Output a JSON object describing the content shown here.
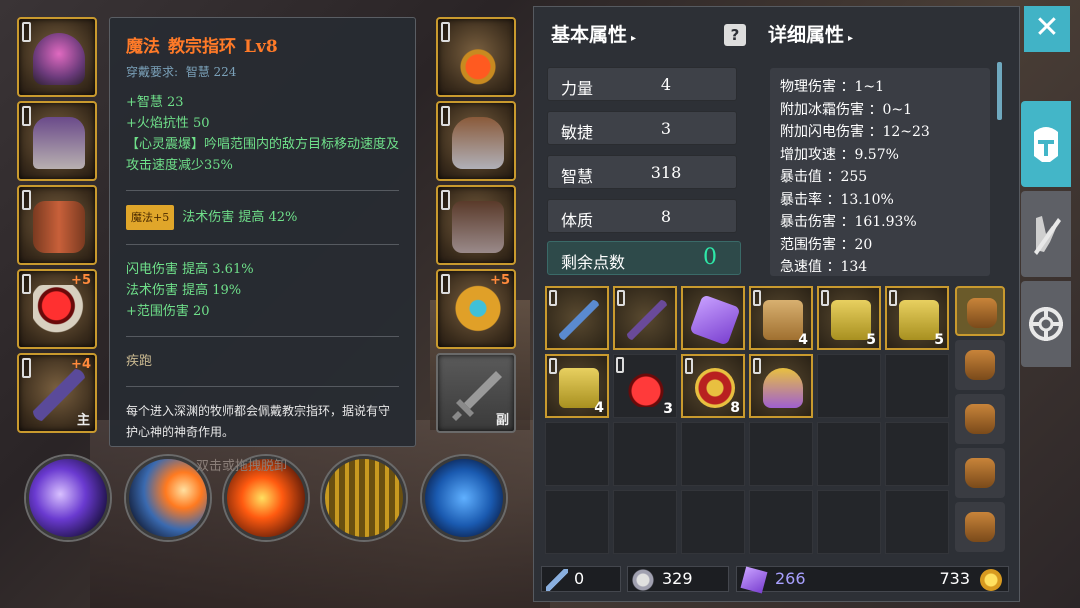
{
  "tooltip": {
    "type": "魔法",
    "name": "教宗指环",
    "level": "Lv8",
    "requirement_label": "穿戴要求:",
    "requirement_stat": "智慧",
    "requirement_value": "224",
    "base_stats": [
      "+智慧 23",
      "+火焰抗性 50",
      "【心灵震爆】吟唱范围内的敌方目标移动速度及攻击速度减少35%"
    ],
    "enchant_badge": "魔法+5",
    "enchant_text": "法术伤害 提高 42%",
    "extra_stats": [
      "闪电伤害 提高 3.61%",
      "法术伤害 提高 19%",
      "+范围伤害 20"
    ],
    "set_skill": "疾跑",
    "description": "每个进入深渊的牧师都会佩戴教宗指环，据说有守护心神的神奇作用。"
  },
  "equipment": {
    "weapon_plus": "+4",
    "weapon_sub": "主",
    "ring_left_plus": "+5",
    "ring_right_plus": "+5",
    "offhand_sub": "副"
  },
  "skills_hint": "双击或拖拽脱卸",
  "attributes": {
    "header": "基本属性",
    "items": [
      {
        "label": "力量",
        "value": "4"
      },
      {
        "label": "敏捷",
        "value": "3"
      },
      {
        "label": "智慧",
        "value": "318"
      },
      {
        "label": "体质",
        "value": "8"
      }
    ],
    "remaining_label": "剩余点数",
    "remaining_value": "0"
  },
  "details": {
    "header": "详细属性",
    "lines": [
      "物理伤害 ：1~1",
      "附加冰霜伤害 ：0~1",
      "附加闪电伤害 ：12~23",
      "增加攻速 ：9.57%",
      "暴击值 ：255",
      "暴击率 ：13.10%",
      "暴击伤害 ：161.93%",
      "范围伤害 ：20",
      "急速值 ：134"
    ]
  },
  "inventory": {
    "counts": [
      "4",
      "5",
      "5",
      "4",
      "3",
      "8"
    ]
  },
  "currency": {
    "wands": "0",
    "gems": "329",
    "crystals": "266",
    "gold": "733"
  },
  "colors": {
    "accent": "#41b3c6",
    "gold_border": "#c99a2e",
    "tooltip_title": "#ff7a28",
    "stat_green": "#6fe08a"
  }
}
